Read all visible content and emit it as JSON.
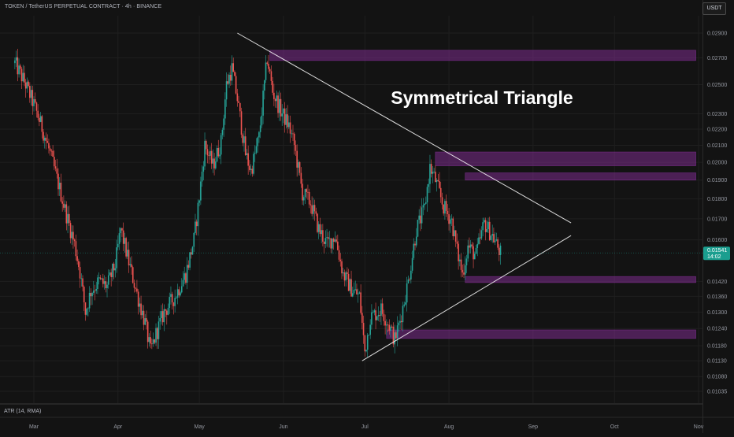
{
  "header": {
    "title": "TOKEN / TetherUS PERPETUAL CONTRACT · 4h · BINANCE",
    "currency": "USDT"
  },
  "indicator_label": "ATR (14, RMA)",
  "annotation": "Symmetrical Triangle",
  "last_price": {
    "value": "0.01541",
    "countdown": "14:02",
    "color": "#1a9e8f"
  },
  "colors": {
    "background": "#131313",
    "up": "#26a69a",
    "down": "#ef5350",
    "zone": "#7b2c8c",
    "trendline": "#ffffff"
  },
  "chart_data": {
    "type": "candlestick",
    "title": "",
    "xlabel": "",
    "ylabel": "",
    "scale": "log",
    "ylim": [
      0.01035,
      0.029
    ],
    "y_ticks": [
      "0.02900",
      "0.02700",
      "0.02500",
      "0.02300",
      "0.02200",
      "0.02100",
      "0.02000",
      "0.01900",
      "0.01800",
      "0.01700",
      "0.01600",
      "0.01420",
      "0.01360",
      "0.01300",
      "0.01240",
      "0.01180",
      "0.01130",
      "0.01080",
      "0.01035"
    ],
    "x_ticks": [
      "Mar",
      "Apr",
      "May",
      "Jun",
      "Jul",
      "Aug",
      "Sep",
      "Oct",
      "Nov"
    ],
    "price_path": [
      [
        "2025-02-22",
        0.0266
      ],
      [
        "2025-02-26",
        0.025
      ],
      [
        "2025-03-01",
        0.0236
      ],
      [
        "2025-03-04",
        0.0221
      ],
      [
        "2025-03-07",
        0.0205
      ],
      [
        "2025-03-10",
        0.0188
      ],
      [
        "2025-03-13",
        0.0172
      ],
      [
        "2025-03-16",
        0.0158
      ],
      [
        "2025-03-18",
        0.0146
      ],
      [
        "2025-03-20",
        0.013
      ],
      [
        "2025-03-22",
        0.0138
      ],
      [
        "2025-03-25",
        0.0142
      ],
      [
        "2025-03-28",
        0.014
      ],
      [
        "2025-03-31",
        0.0149
      ],
      [
        "2025-04-02",
        0.0165
      ],
      [
        "2025-04-05",
        0.015
      ],
      [
        "2025-04-08",
        0.0137
      ],
      [
        "2025-04-11",
        0.0126
      ],
      [
        "2025-04-13",
        0.0116
      ],
      [
        "2025-04-15",
        0.0122
      ],
      [
        "2025-04-18",
        0.013
      ],
      [
        "2025-04-22",
        0.0136
      ],
      [
        "2025-04-26",
        0.0145
      ],
      [
        "2025-04-29",
        0.016
      ],
      [
        "2025-05-01",
        0.0181
      ],
      [
        "2025-05-03",
        0.021
      ],
      [
        "2025-05-06",
        0.0198
      ],
      [
        "2025-05-09",
        0.0212
      ],
      [
        "2025-05-11",
        0.025
      ],
      [
        "2025-05-13",
        0.0262
      ],
      [
        "2025-05-15",
        0.024
      ],
      [
        "2025-05-18",
        0.0205
      ],
      [
        "2025-05-20",
        0.0195
      ],
      [
        "2025-05-23",
        0.0215
      ],
      [
        "2025-05-26",
        0.027
      ],
      [
        "2025-05-28",
        0.0245
      ],
      [
        "2025-05-31",
        0.0232
      ],
      [
        "2025-06-03",
        0.0222
      ],
      [
        "2025-06-05",
        0.021
      ],
      [
        "2025-06-08",
        0.0183
      ],
      [
        "2025-06-11",
        0.0178
      ],
      [
        "2025-06-14",
        0.0165
      ],
      [
        "2025-06-17",
        0.0158
      ],
      [
        "2025-06-20",
        0.0162
      ],
      [
        "2025-06-23",
        0.0145
      ],
      [
        "2025-06-26",
        0.0139
      ],
      [
        "2025-06-29",
        0.0136
      ],
      [
        "2025-07-01",
        0.0116
      ],
      [
        "2025-07-03",
        0.0128
      ],
      [
        "2025-07-07",
        0.0131
      ],
      [
        "2025-07-10",
        0.0125
      ],
      [
        "2025-07-12",
        0.012
      ],
      [
        "2025-07-14",
        0.0127
      ],
      [
        "2025-07-17",
        0.0142
      ],
      [
        "2025-07-20",
        0.0165
      ],
      [
        "2025-07-23",
        0.0175
      ],
      [
        "2025-07-25",
        0.0197
      ],
      [
        "2025-07-27",
        0.019
      ],
      [
        "2025-07-30",
        0.0176
      ],
      [
        "2025-08-02",
        0.0169
      ],
      [
        "2025-08-04",
        0.0155
      ],
      [
        "2025-08-06",
        0.0145
      ],
      [
        "2025-08-08",
        0.0157
      ],
      [
        "2025-08-11",
        0.0153
      ],
      [
        "2025-08-14",
        0.0168
      ],
      [
        "2025-08-17",
        0.0162
      ],
      [
        "2025-08-20",
        0.0154
      ]
    ],
    "triangle": {
      "upper": [
        [
          "2025-05-15",
          0.029
        ],
        [
          "2025-09-15",
          0.0168
        ]
      ],
      "lower": [
        [
          "2025-06-30",
          0.0113
        ],
        [
          "2025-09-15",
          0.0162
        ]
      ]
    },
    "zones": [
      {
        "from": "2025-05-27",
        "to": "2025-10-31",
        "low": 0.0268,
        "high": 0.0276
      },
      {
        "from": "2025-07-27",
        "to": "2025-10-31",
        "low": 0.0198,
        "high": 0.0206
      },
      {
        "from": "2025-08-07",
        "to": "2025-10-31",
        "low": 0.019,
        "high": 0.0194
      },
      {
        "from": "2025-08-07",
        "to": "2025-10-31",
        "low": 0.01415,
        "high": 0.0144
      },
      {
        "from": "2025-07-09",
        "to": "2025-10-31",
        "low": 0.01205,
        "high": 0.01235
      }
    ],
    "grid": true
  }
}
